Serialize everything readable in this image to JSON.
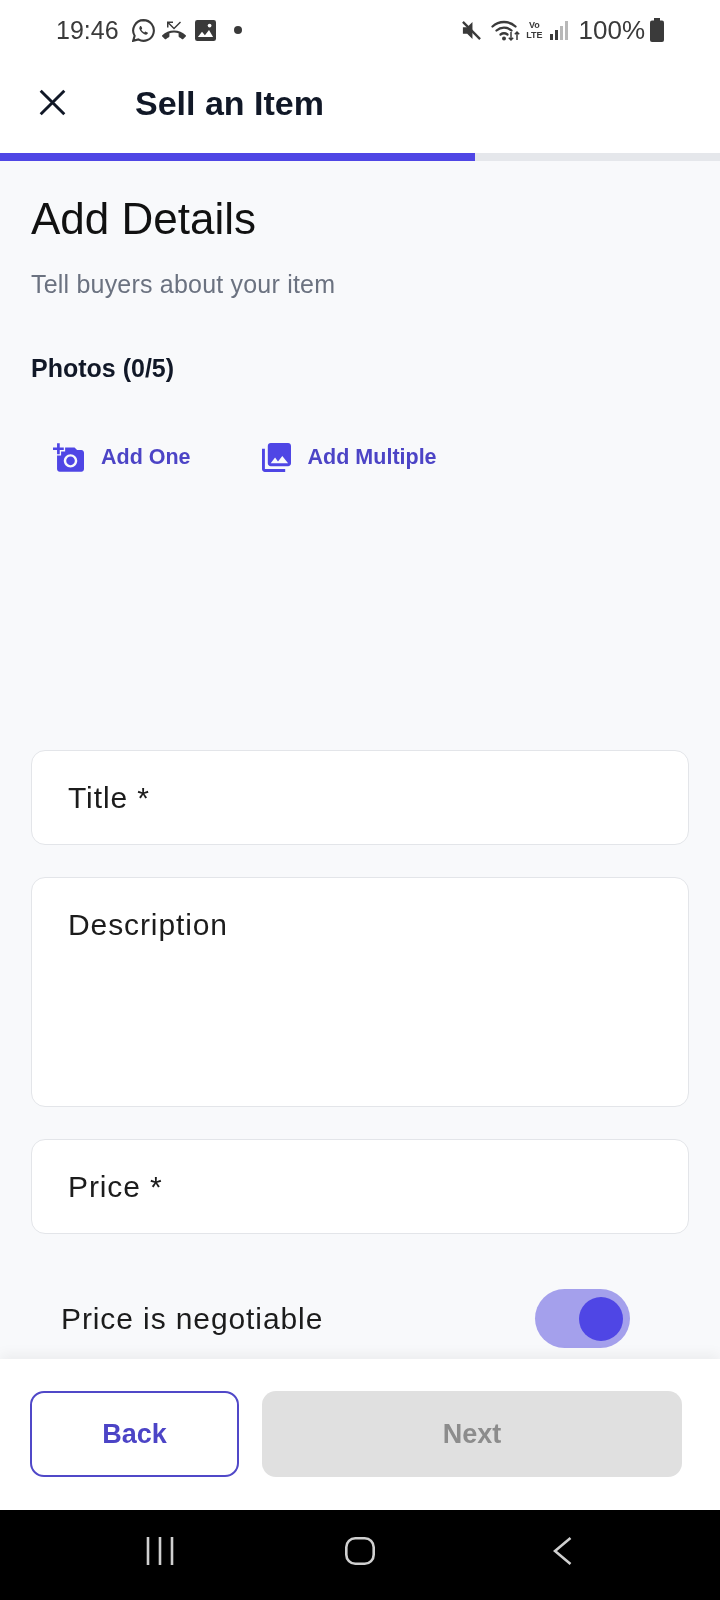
{
  "status_bar": {
    "time": "19:46",
    "network_type": [
      "Vo",
      "LTE"
    ],
    "battery": "100%"
  },
  "header": {
    "title": "Sell an Item"
  },
  "progress": {
    "level": 0.66
  },
  "page": {
    "heading": "Add Details",
    "subheading": "Tell buyers about your item"
  },
  "photos": {
    "label": "Photos (0/5)",
    "actions": [
      {
        "label": "Add One",
        "kind": "camera"
      },
      {
        "label": "Add Multiple",
        "kind": "gallery"
      }
    ]
  },
  "fields": [
    {
      "placeholder": "Title *",
      "kind": "single"
    },
    {
      "placeholder": "Description",
      "kind": "multiline"
    },
    {
      "placeholder": "Price *",
      "kind": "single"
    }
  ],
  "negotiable": {
    "label": "Price is negotiable",
    "on": true
  },
  "footer": {
    "buttons": [
      {
        "label": "Back",
        "kind": "outline",
        "disabled": false
      },
      {
        "label": "Next",
        "kind": "filled",
        "disabled": true
      }
    ]
  }
}
